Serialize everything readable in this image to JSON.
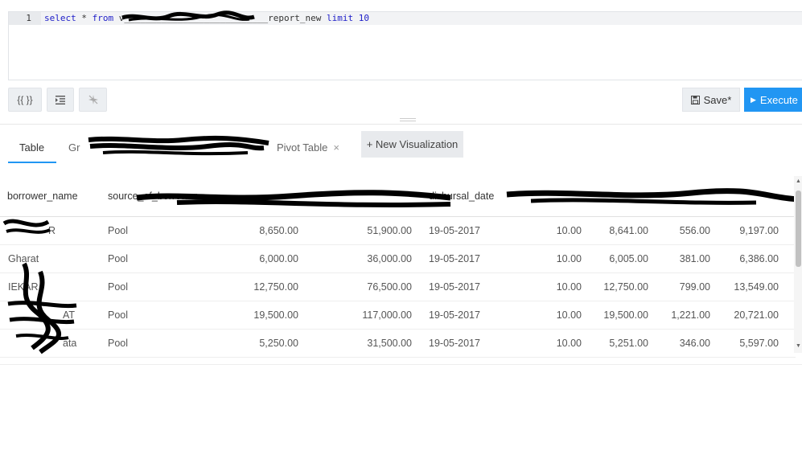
{
  "editor": {
    "line_number": "1",
    "query_parts": {
      "select": "select",
      "star": " * ",
      "from": "from",
      "table": " v___________________________report_new ",
      "limit": "limit",
      "limit_value": "10"
    }
  },
  "toolbar": {
    "template_label": "{{ }}",
    "format_icon": "indent-icon",
    "autocomplete_icon": "autocomplete-off-icon",
    "save_label": "Save*",
    "execute_label": "Execute"
  },
  "tabs": [
    {
      "label": "Table"
    },
    {
      "label": "Gr"
    },
    {
      "label": "Pivot Table"
    }
  ],
  "new_visualization_label": "+ New Visualization",
  "table": {
    "columns": [
      "borrower_name",
      "source_of_borrower",
      "",
      "",
      "disbursal_date",
      "",
      "",
      "",
      ""
    ],
    "rows": [
      [
        "R",
        "Pool",
        "8,650.00",
        "51,900.00",
        "19-05-2017",
        "10.00",
        "8,641.00",
        "556.00",
        "9,197.00"
      ],
      [
        "Gharat",
        "Pool",
        "6,000.00",
        "36,000.00",
        "19-05-2017",
        "10.00",
        "6,005.00",
        "381.00",
        "6,386.00"
      ],
      [
        "IEKAR",
        "Pool",
        "12,750.00",
        "76,500.00",
        "19-05-2017",
        "10.00",
        "12,750.00",
        "799.00",
        "13,549.00"
      ],
      [
        "AT",
        "Pool",
        "19,500.00",
        "117,000.00",
        "19-05-2017",
        "10.00",
        "19,500.00",
        "1,221.00",
        "20,721.00"
      ],
      [
        "ata",
        "Pool",
        "5,250.00",
        "31,500.00",
        "19-05-2017",
        "10.00",
        "5,251.00",
        "346.00",
        "5,597.00"
      ]
    ]
  },
  "colors": {
    "accent": "#2196f3",
    "keyword": "#1d1dc8",
    "redaction": "#000000"
  }
}
